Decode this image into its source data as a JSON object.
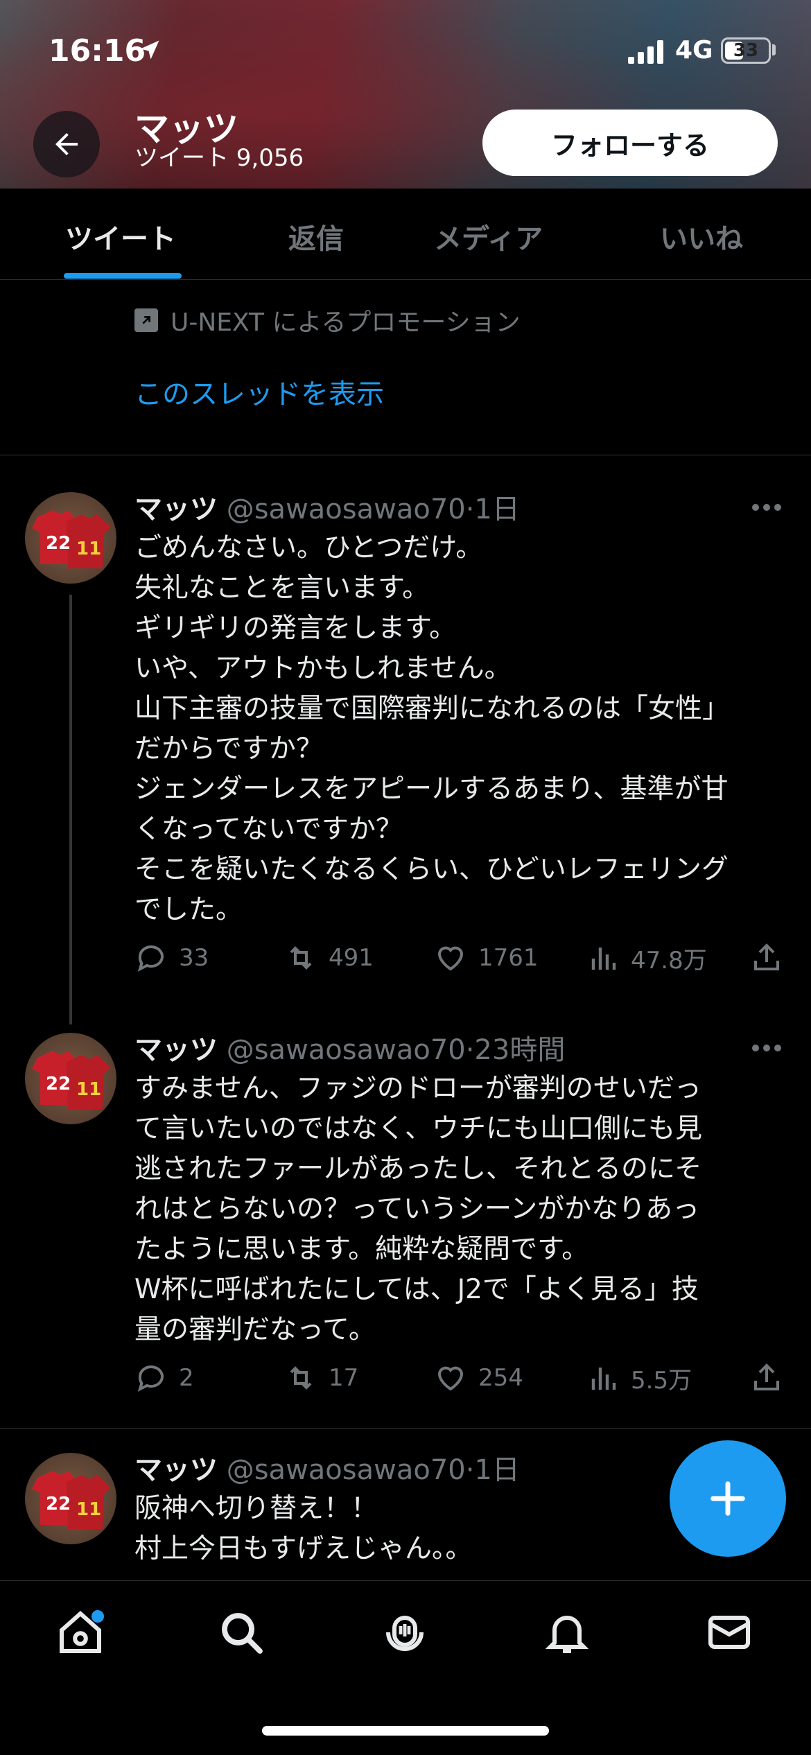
{
  "status_bar": {
    "time": "16:16",
    "network": "4G",
    "battery": "33"
  },
  "header": {
    "name": "マッツ",
    "tweet_count": "ツイート 9,056",
    "follow_label": "フォローする"
  },
  "tabs": [
    {
      "label": "ツイート",
      "active": true
    },
    {
      "label": "返信",
      "active": false
    },
    {
      "label": "メディア",
      "active": false
    },
    {
      "label": "いいね",
      "active": false
    }
  ],
  "promo": {
    "text": "U-NEXT によるプロモーション",
    "show_thread": "このスレッドを表示"
  },
  "tweets": [
    {
      "name": "マッツ",
      "handle": "@sawaosawao70",
      "time": "·1日",
      "body": "ごめんなさい。ひとつだけ。\n失礼なことを言います。\nギリギリの発言をします。\nいや、アウトかもしれません。\n山下主審の技量で国際審判になれるのは「女性」\nだからですか？\nジェンダーレスをアピールするあまり、基準が甘\nくなってないですか？\nそこを疑いたくなるくらい、ひどいレフェリング\nでした。",
      "replies": "33",
      "retweets": "491",
      "likes": "1761",
      "views": "47.8万"
    },
    {
      "name": "マッツ",
      "handle": "@sawaosawao70",
      "time": "·23時間",
      "body": "すみません、ファジのドローが審判のせいだっ\nて言いたいのではなく、ウチにも山口側にも見\n逃されたファールがあったし、それとるのにそ\nれはとらないの？っていうシーンがかなりあっ\nたように思います。純粋な疑問です。\nW杯に呼ばれたにしては、J2で「よく見る」技\n量の審判だなって。",
      "replies": "2",
      "retweets": "17",
      "likes": "254",
      "views": "5.5万"
    },
    {
      "name": "マッツ",
      "handle": "@sawaosawao70",
      "time": "·1日",
      "body": "阪神へ切り替え！！\n村上今日もすげえじゃん。。"
    }
  ],
  "avatar_jersey_numbers": [
    "22",
    "11"
  ],
  "colors": {
    "accent": "#1d9bf0",
    "background": "#000000",
    "muted": "#71767b"
  }
}
